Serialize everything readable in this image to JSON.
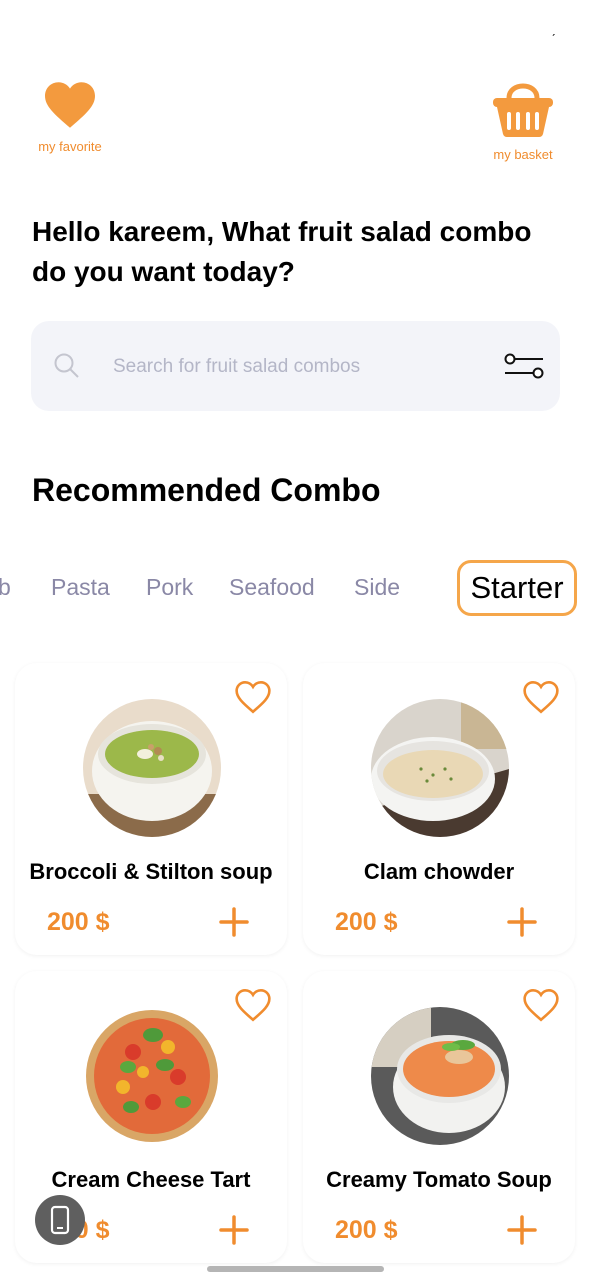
{
  "status": {
    "mark": "ˏ"
  },
  "header": {
    "favorite_label": "my favorite",
    "basket_label": "my basket"
  },
  "greeting": "Hello kareem, What fruit salad combo do you want today?",
  "search": {
    "placeholder": "Search for fruit salad combos",
    "value": ""
  },
  "section_title": "Recommended Combo",
  "tabs": [
    {
      "label": "Lamb",
      "visible_text": "b"
    },
    {
      "label": "Pasta"
    },
    {
      "label": "Pork"
    },
    {
      "label": "Seafood"
    },
    {
      "label": "Side"
    },
    {
      "label": "Starter",
      "selected": true
    }
  ],
  "products": [
    {
      "name": "Broccoli & Stilton soup",
      "price": "200 $"
    },
    {
      "name": "Clam chowder",
      "price": "200 $"
    },
    {
      "name": "Cream Cheese Tart",
      "price": "200 $"
    },
    {
      "name": "Creamy Tomato Soup",
      "price": "200 $"
    }
  ],
  "icons": {
    "favorite": "heart-icon",
    "basket": "basket-icon",
    "search": "search-icon",
    "filter": "filter-icon",
    "add": "plus-icon",
    "phone": "phone-icon"
  },
  "colors": {
    "accent": "#f08c2e",
    "tab_inactive": "#8a88a6",
    "search_bg": "#f3f4f9"
  }
}
